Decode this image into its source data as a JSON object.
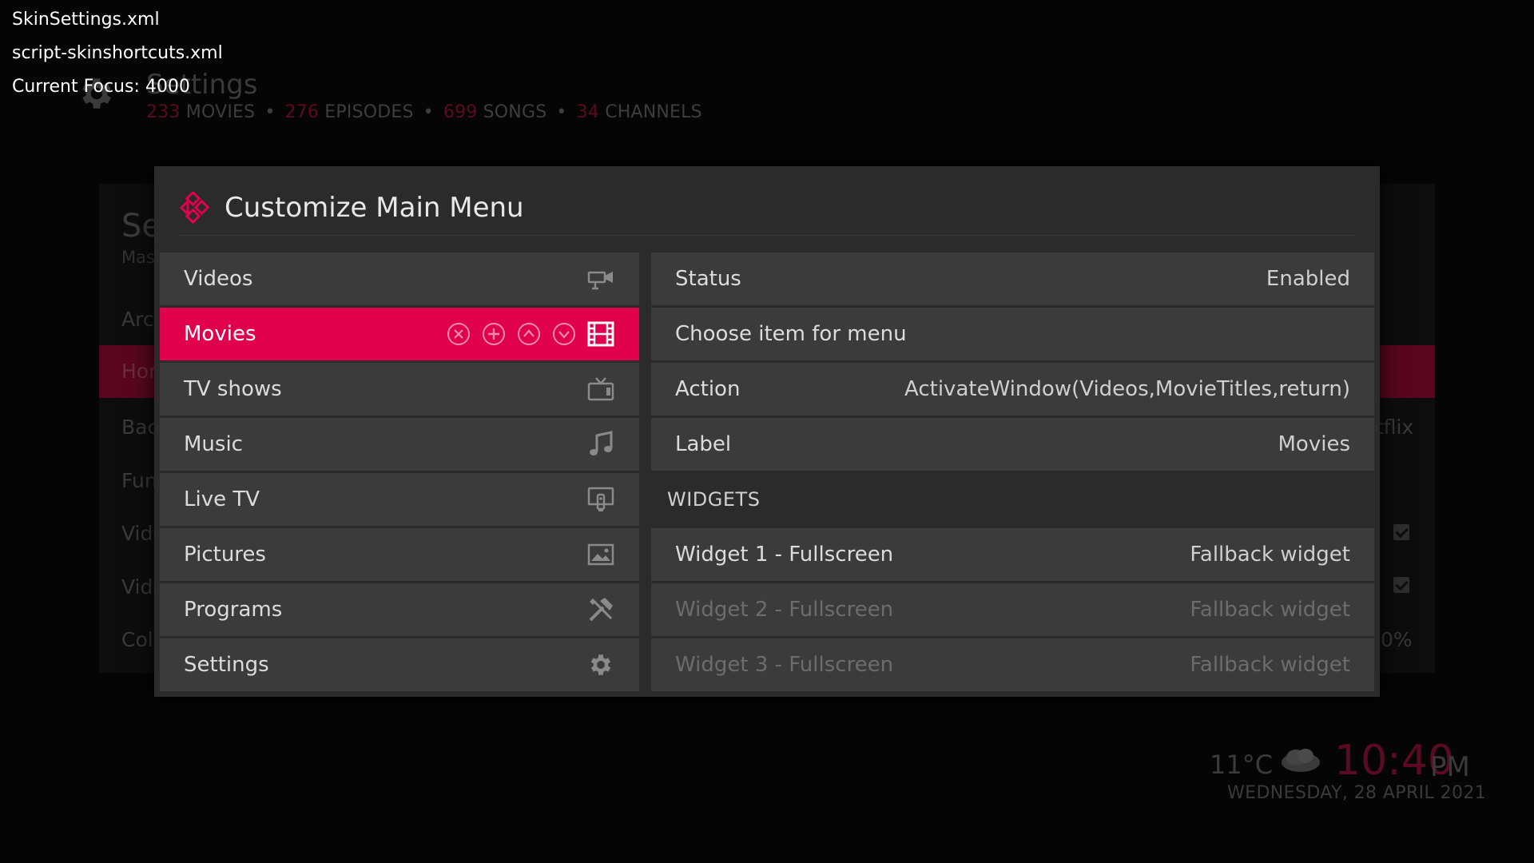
{
  "debug": {
    "line1": "SkinSettings.xml",
    "line2": "script-skinshortcuts.xml",
    "line3": "Current Focus: 4000"
  },
  "background": {
    "title": "Settings",
    "stats": [
      {
        "num": "233",
        "label": "MOVIES"
      },
      {
        "num": "276",
        "label": "EPISODES"
      },
      {
        "num": "699",
        "label": "SONGS"
      },
      {
        "num": "34",
        "label": "CHANNELS"
      }
    ],
    "stats_separator": "•",
    "panel_title": "Se",
    "panel_sub": "Mas",
    "list_items": [
      "Arc",
      "Hor",
      "Bac",
      "Fun",
      "Vide",
      "Vide",
      "Col"
    ],
    "right_texts": {
      "netflix": "tflix",
      "percent": "0%"
    },
    "weather": {
      "temp": "11°C",
      "icon": "cloudy-icon"
    },
    "time": "10:40",
    "ampm": "PM",
    "date": "WEDNESDAY, 28 APRIL 2021"
  },
  "dialog": {
    "title": "Customize Main Menu",
    "menu": [
      {
        "label": "Videos",
        "icon": "video-camera-icon"
      },
      {
        "label": "Movies",
        "icon": "film-icon",
        "focused": true
      },
      {
        "label": "TV shows",
        "icon": "tv-icon"
      },
      {
        "label": "Music",
        "icon": "music-note-icon"
      },
      {
        "label": "Live TV",
        "icon": "live-tv-icon"
      },
      {
        "label": "Pictures",
        "icon": "picture-icon"
      },
      {
        "label": "Programs",
        "icon": "tools-icon"
      },
      {
        "label": "Settings",
        "icon": "gear-icon"
      }
    ],
    "properties": [
      {
        "label": "Status",
        "value": "Enabled"
      },
      {
        "label": "Choose item for menu",
        "value": ""
      },
      {
        "label": "Action",
        "value": "ActivateWindow(Videos,MovieTitles,return)"
      },
      {
        "label": "Label",
        "value": "Movies"
      }
    ],
    "widgets_header": "WIDGETS",
    "widgets": [
      {
        "label": "Widget 1 - Fullscreen",
        "value": "Fallback widget",
        "dim": false
      },
      {
        "label": "Widget 2 - Fullscreen",
        "value": "Fallback widget",
        "dim": true
      },
      {
        "label": "Widget 3 - Fullscreen",
        "value": "Fallback widget",
        "dim": true
      }
    ]
  },
  "colors": {
    "accent": "#e1004c",
    "dialog_bg": "#2b2b2b",
    "row_bg": "#3b3b3b"
  }
}
